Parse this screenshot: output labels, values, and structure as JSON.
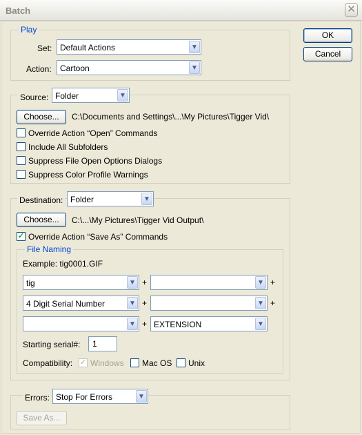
{
  "window": {
    "title": "Batch",
    "close_symbol": "✕"
  },
  "buttons": {
    "ok": "OK",
    "cancel": "Cancel"
  },
  "play": {
    "legend": "Play",
    "set_label": "Set:",
    "set_value": "Default Actions",
    "action_label": "Action:",
    "action_value": "Cartoon"
  },
  "source": {
    "label": "Source:",
    "value": "Folder",
    "choose_label": "Choose...",
    "path": "C:\\Documents and Settings\\...\\My Pictures\\Tigger Vid\\",
    "options": [
      {
        "label": "Override Action “Open” Commands",
        "checked": false
      },
      {
        "label": "Include All Subfolders",
        "checked": false
      },
      {
        "label": "Suppress File Open Options Dialogs",
        "checked": false
      },
      {
        "label": "Suppress Color Profile Warnings",
        "checked": false
      }
    ]
  },
  "destination": {
    "label": "Destination:",
    "value": "Folder",
    "choose_label": "Choose...",
    "path": "C:\\...\\My Pictures\\Tigger Vid Output\\",
    "override_label": "Override Action “Save As” Commands",
    "override_checked": true,
    "file_naming": {
      "legend": "File Naming",
      "example": "Example: tig0001.GIF",
      "rows": [
        [
          "tig",
          ""
        ],
        [
          "4 Digit Serial Number",
          ""
        ],
        [
          "",
          "EXTENSION"
        ]
      ],
      "plus": "+",
      "serial_label": "Starting serial#:",
      "serial_value": "1",
      "compat_label": "Compatibility:",
      "compat": [
        {
          "label": "Windows",
          "checked": true,
          "disabled": true
        },
        {
          "label": "Mac OS",
          "checked": false,
          "disabled": false
        },
        {
          "label": "Unix",
          "checked": false,
          "disabled": false
        }
      ]
    }
  },
  "errors": {
    "label": "Errors:",
    "value": "Stop For Errors",
    "save_as_label": "Save As..."
  },
  "icons": {
    "dropdown_arrow": "▼",
    "checkmark": "✓"
  }
}
